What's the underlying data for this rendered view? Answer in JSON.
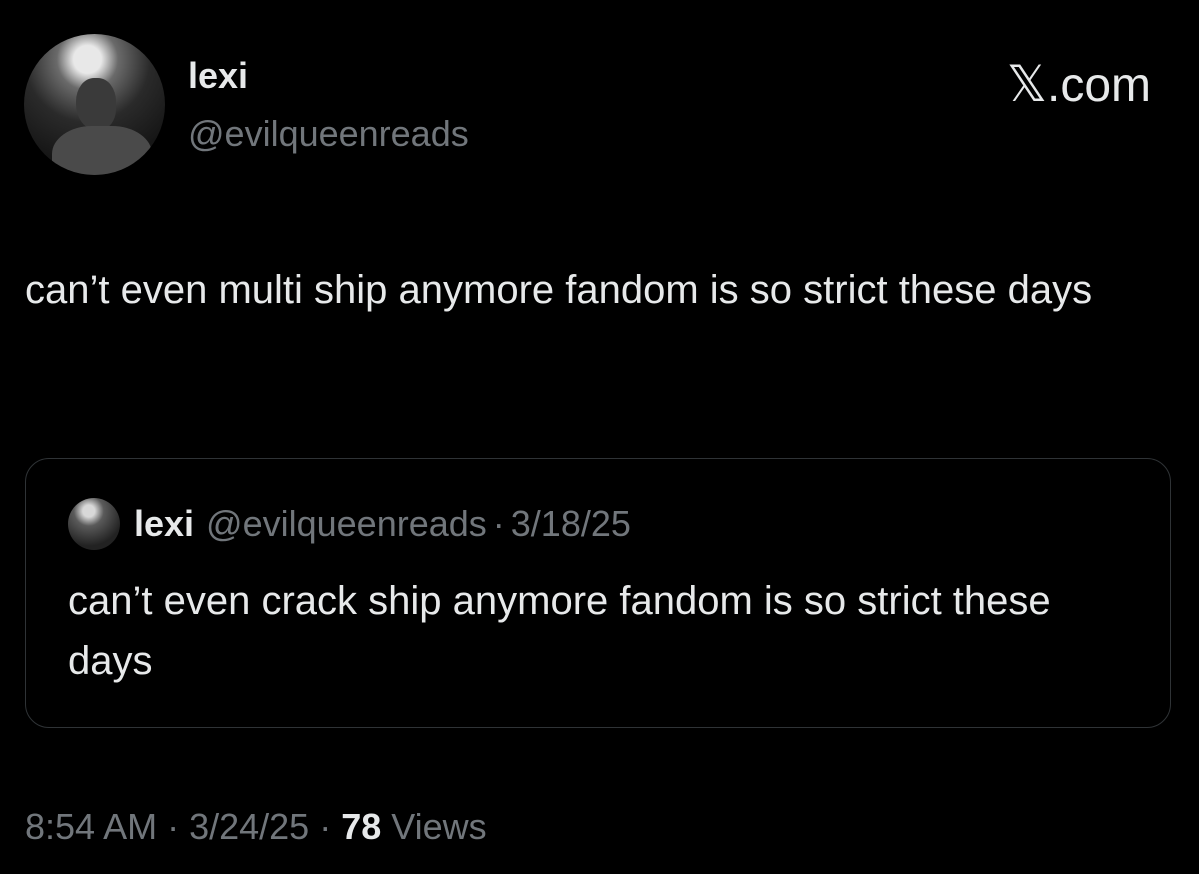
{
  "author": {
    "display_name": "lexi",
    "handle": "@evilqueenreads"
  },
  "brand": {
    "symbol": "𝕏",
    "suffix": ".com"
  },
  "tweet": {
    "text": "can’t even multi ship anymore fandom is so strict these days",
    "time": "8:54 AM",
    "date": "3/24/25",
    "views_count": "78",
    "views_label": "Views",
    "separator": "·"
  },
  "quoted_tweet": {
    "display_name": "lexi",
    "handle": "@evilqueenreads",
    "separator": "·",
    "date": "3/18/25",
    "text": "can’t even crack ship anymore fandom is so strict these days"
  },
  "colors": {
    "background": "#000000",
    "primary_text": "#e7e9ea",
    "secondary_text": "#71767b",
    "border": "#2f3336"
  }
}
